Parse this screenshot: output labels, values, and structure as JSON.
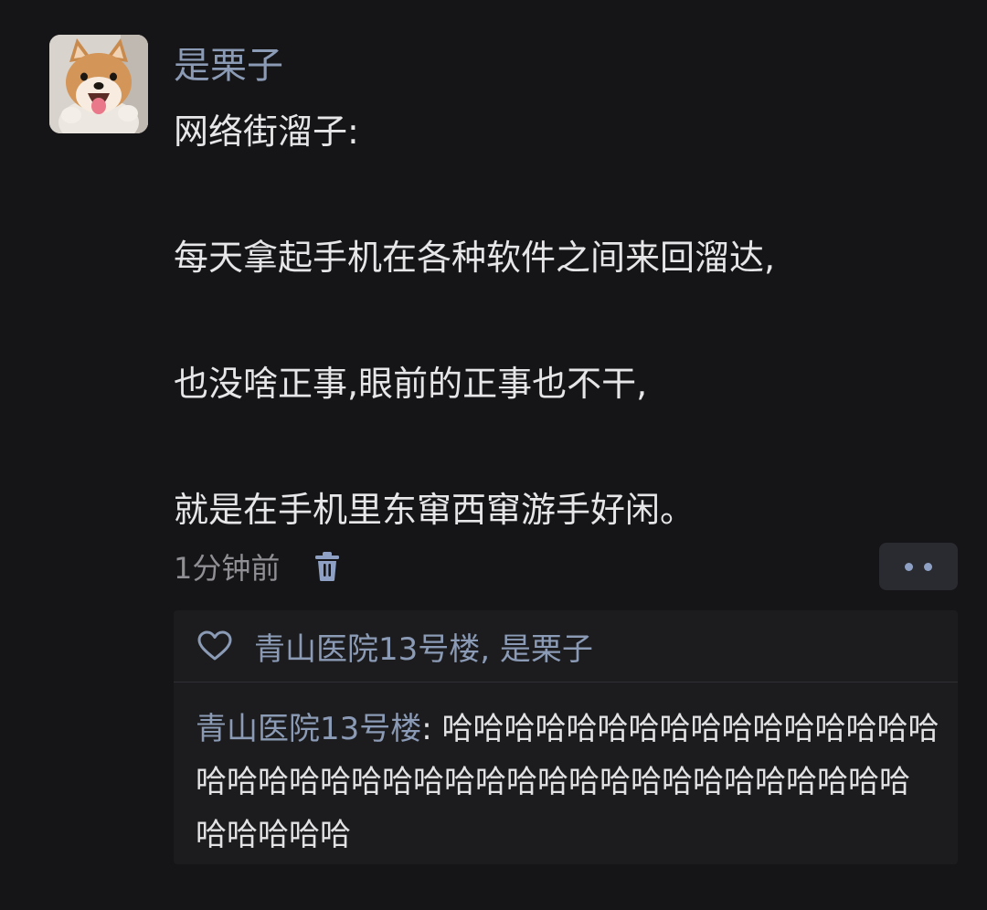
{
  "post": {
    "username": "是栗子",
    "lines": [
      "网络街溜子:",
      "每天拿起手机在各种软件之间来回溜达,",
      "也没啥正事,眼前的正事也不干,",
      "就是在手机里东窜西窜游手好闲。"
    ],
    "timestamp": "1分钟前",
    "avatar_icon": "shiba-dog-avatar",
    "delete_icon": "trash-icon",
    "more_icon": "more-dots-icon"
  },
  "likes": {
    "icon": "heart-outline-icon",
    "names": "青山医院13号楼, 是栗子"
  },
  "comments": [
    {
      "author": "青山医院13号楼",
      "separator": ": ",
      "text": "哈哈哈哈哈哈哈哈哈哈哈哈哈哈哈哈哈哈哈哈哈哈哈哈哈哈哈哈哈哈哈哈哈哈哈哈哈哈哈哈哈哈哈哈"
    }
  ],
  "colors": {
    "background": "#151416",
    "name_link": "#8b9bb6",
    "body_text": "#e6e6e8",
    "muted_text": "#8f8f94",
    "comment_bg": "#1c1c1f",
    "button_bg": "#2a2b30"
  }
}
